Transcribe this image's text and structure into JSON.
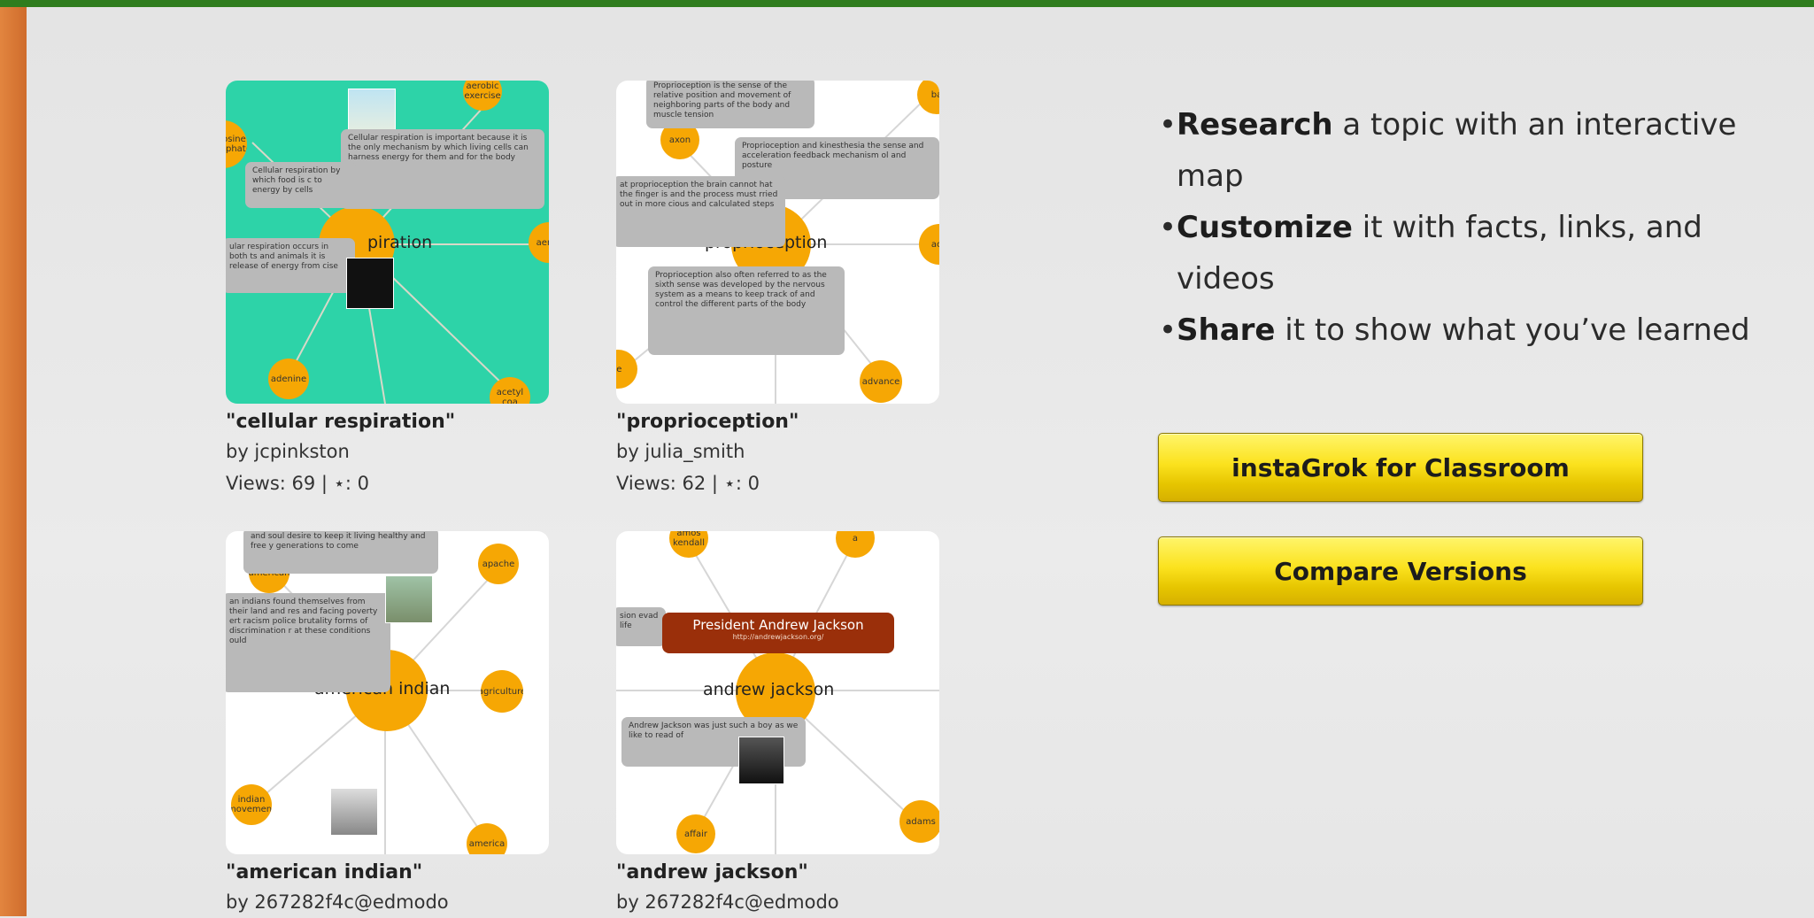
{
  "maps": [
    {
      "title": "\"cellular respiration\"",
      "author": "by jcpinkston",
      "views": "Views: 69 | ⋆: 0",
      "central": "piration",
      "bg": "#2dd3a8",
      "nodes": [
        "aerobic exercise",
        "adenosine triphosphate",
        "aerob",
        "adenine",
        "acetyl coa"
      ],
      "notes": [
        "Cellular respiration is important because it is the only mechanism by which living cells can harness energy for them and for the body",
        "Cellular respiration by which food is c to energy by cells",
        "ular respiration occurs in both ts and animals it is release of energy from cise"
      ]
    },
    {
      "title": "\"proprioception\"",
      "author": "by julia_smith",
      "views": "Views: 62 | ⋆: 0",
      "central": "proprioception",
      "bg": "#ffffff",
      "nodes": [
        "axon",
        "ba",
        "acti",
        "advance",
        "le"
      ],
      "notes": [
        "Proprioception is the sense of the relative position and movement of neighboring parts of the body and muscle tension",
        "Proprioception and kinesthesia the sense and acceleration feedback mechanism ol and posture",
        "at proprioception the brain cannot hat the finger is and the process must rried out in more cious and calculated steps",
        "Proprioception also often referred to as the sixth sense was developed by the nervous system as a means to keep track of and control the different parts of the body"
      ]
    },
    {
      "title": "\"american indian\"",
      "author": "by 267282f4c@edmodo",
      "views": "",
      "central": "american indian",
      "bg": "#ffffff",
      "nodes": [
        "apache",
        "american",
        "agriculture",
        "indian movement",
        "america"
      ],
      "notes": [
        "and soul desire to keep it living healthy and free y generations to come",
        "an indians found themselves from their land and res and facing poverty ert racism police brutality forms of discrimination r at these conditions ould"
      ]
    },
    {
      "title": "\"andrew jackson\"",
      "author": "by 267282f4c@edmodo",
      "views": "",
      "central": "andrew jackson",
      "bg": "#ffffff",
      "nodes": [
        "amos kendall",
        "adams",
        "affair",
        "a"
      ],
      "notes": [
        "Andrew Jackson was just such a boy as we like to read of",
        "sion evad life"
      ],
      "link_title": "President Andrew Jackson",
      "link_url": "http://andrewjackson.org/"
    }
  ],
  "features": [
    {
      "lead": "Research",
      "rest": " a topic with an interactive map"
    },
    {
      "lead": "Customize",
      "rest": " it with facts, links, and videos"
    },
    {
      "lead": "Share",
      "rest": " it to show what you’ve learned"
    }
  ],
  "bullet": "•",
  "buttons": {
    "classroom": "instaGrok for Classroom",
    "compare": "Compare Versions"
  },
  "colors": {
    "top_bar": "#2f7d1e",
    "left_bar": "#d9772f",
    "node": "#f6a704",
    "note": "#b9b9b9",
    "button": "#fbe21e",
    "link_box": "#9a2f0a"
  }
}
